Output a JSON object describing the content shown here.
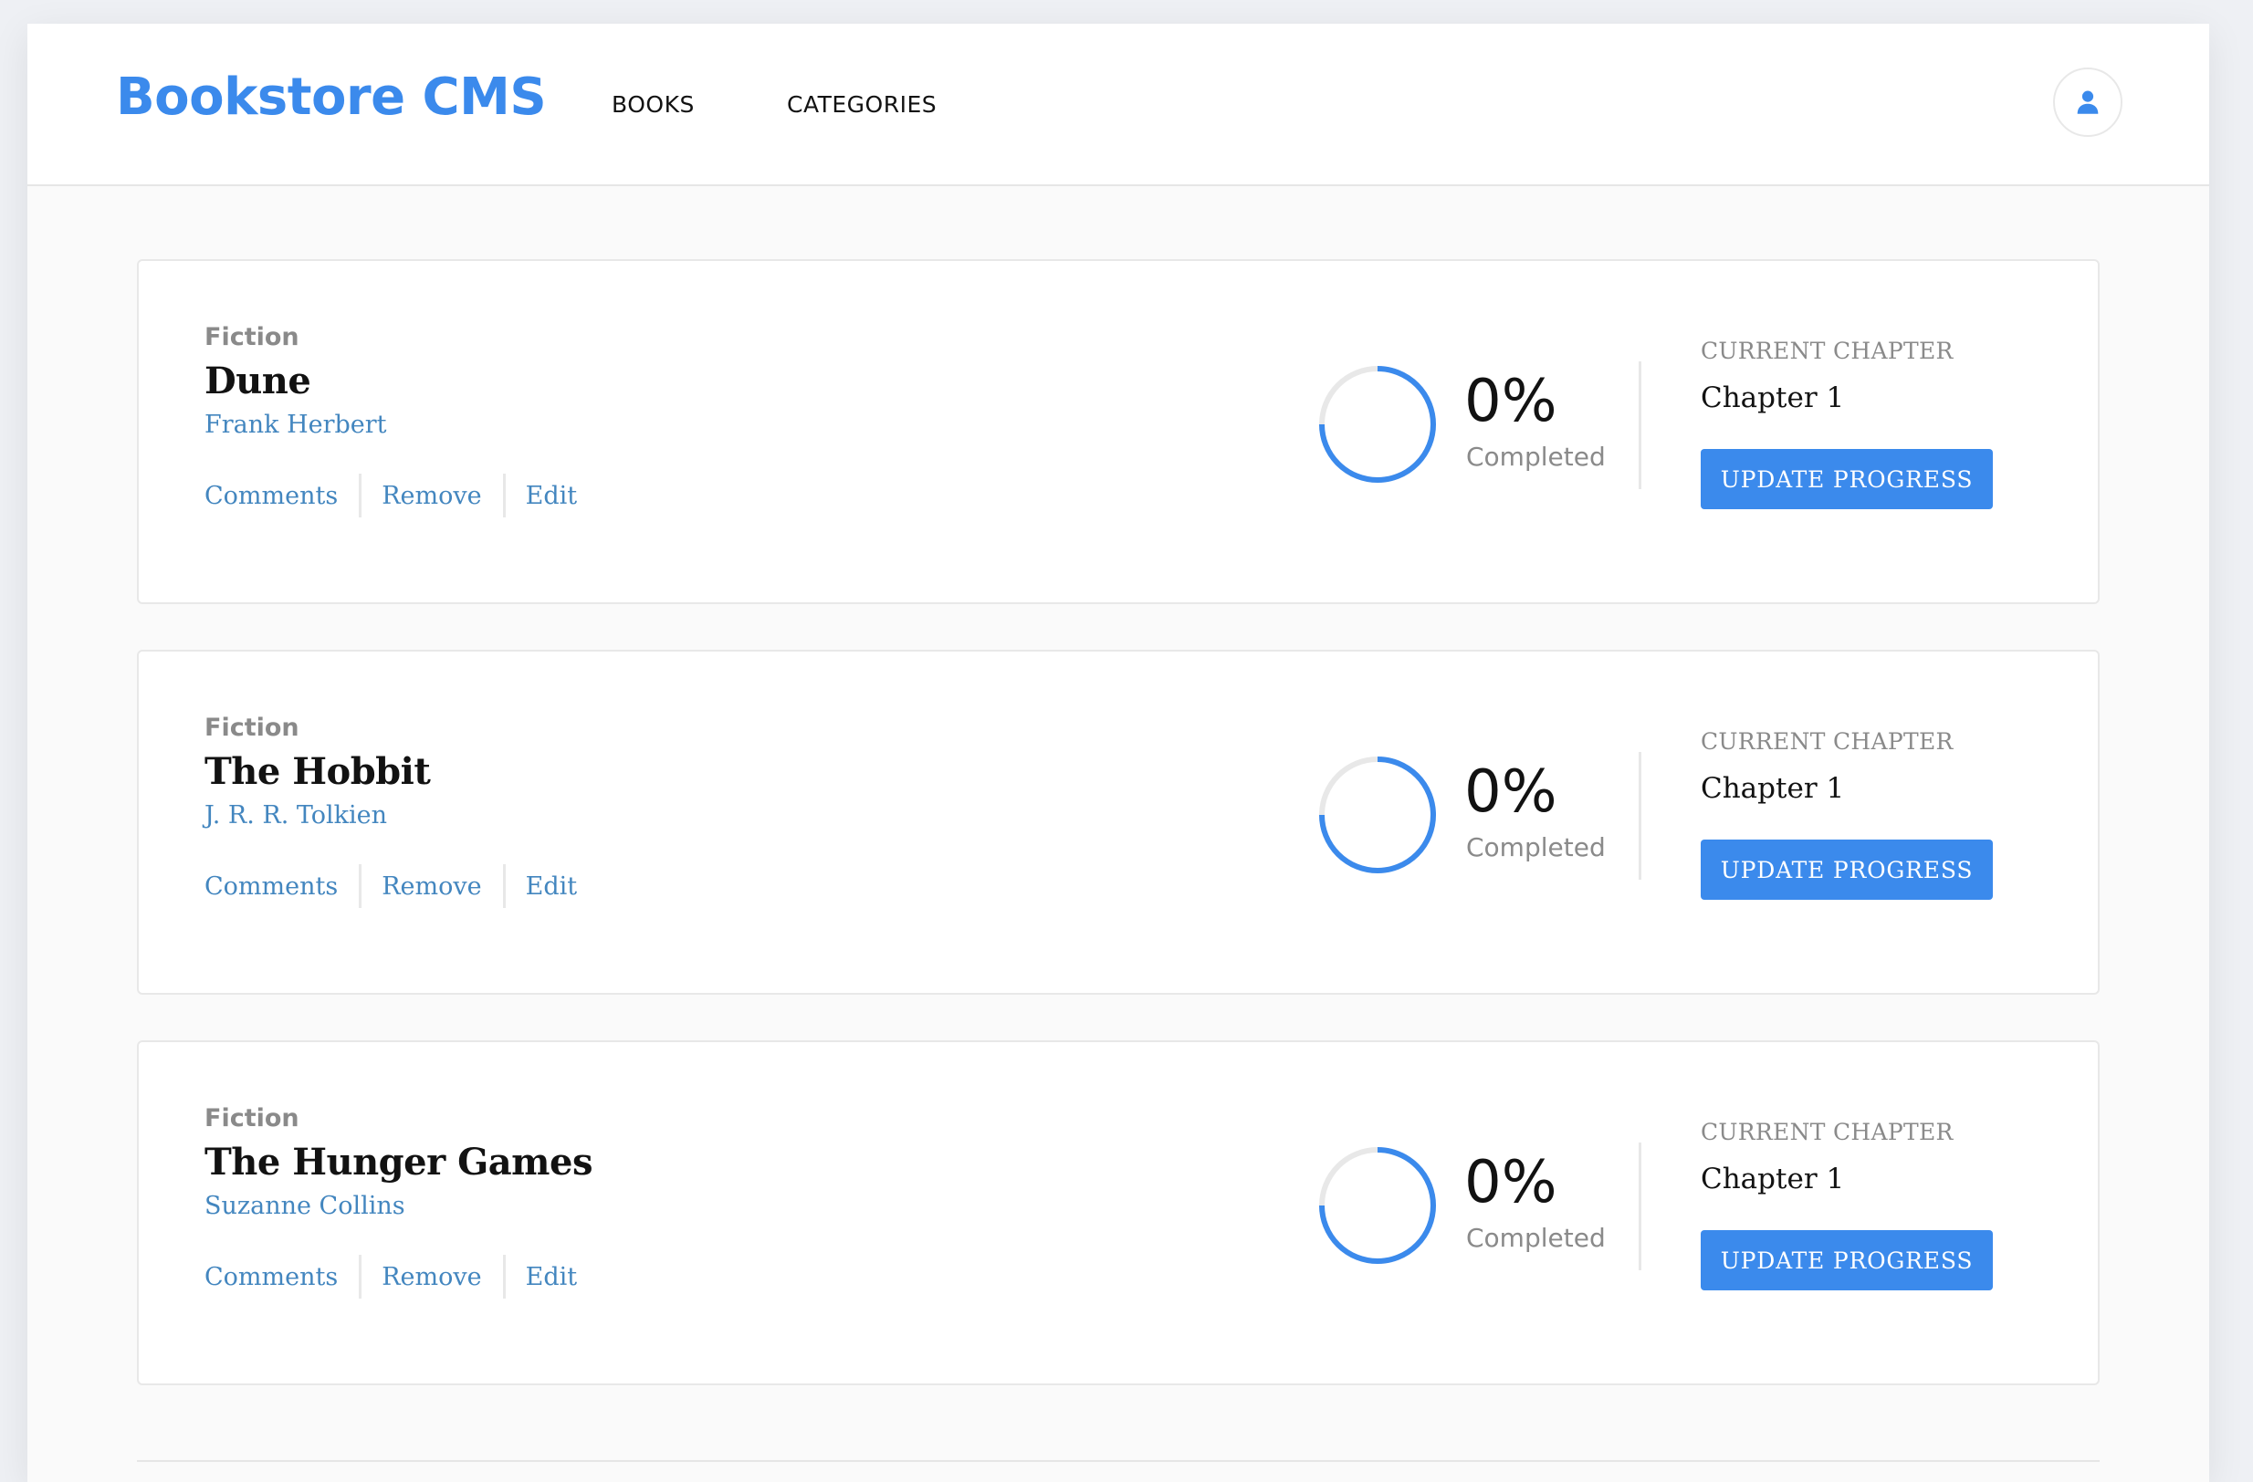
{
  "header": {
    "logo": "Bookstore CMS",
    "nav": [
      {
        "label": "BOOKS"
      },
      {
        "label": "CATEGORIES"
      }
    ],
    "user_icon": "user-icon"
  },
  "labels": {
    "comments": "Comments",
    "remove": "Remove",
    "edit": "Edit",
    "completed": "Completed",
    "current_chapter": "CURRENT CHAPTER",
    "update_progress": "UPDATE PROGRESS"
  },
  "books": [
    {
      "category": "Fiction",
      "title": "Dune",
      "author": "Frank Herbert",
      "progress_percent": 0,
      "progress_label": "0%",
      "chapter": "Chapter 1"
    },
    {
      "category": "Fiction",
      "title": "The Hobbit",
      "author": "J. R. R. Tolkien",
      "progress_percent": 0,
      "progress_label": "0%",
      "chapter": "Chapter 1"
    },
    {
      "category": "Fiction",
      "title": "The Hunger Games",
      "author": "Suzanne Collins",
      "progress_percent": 0,
      "progress_label": "0%",
      "chapter": "Chapter 1"
    }
  ],
  "colors": {
    "accent": "#3b8aec",
    "link": "#4386bf",
    "ring_track": "#e8e8e8"
  }
}
